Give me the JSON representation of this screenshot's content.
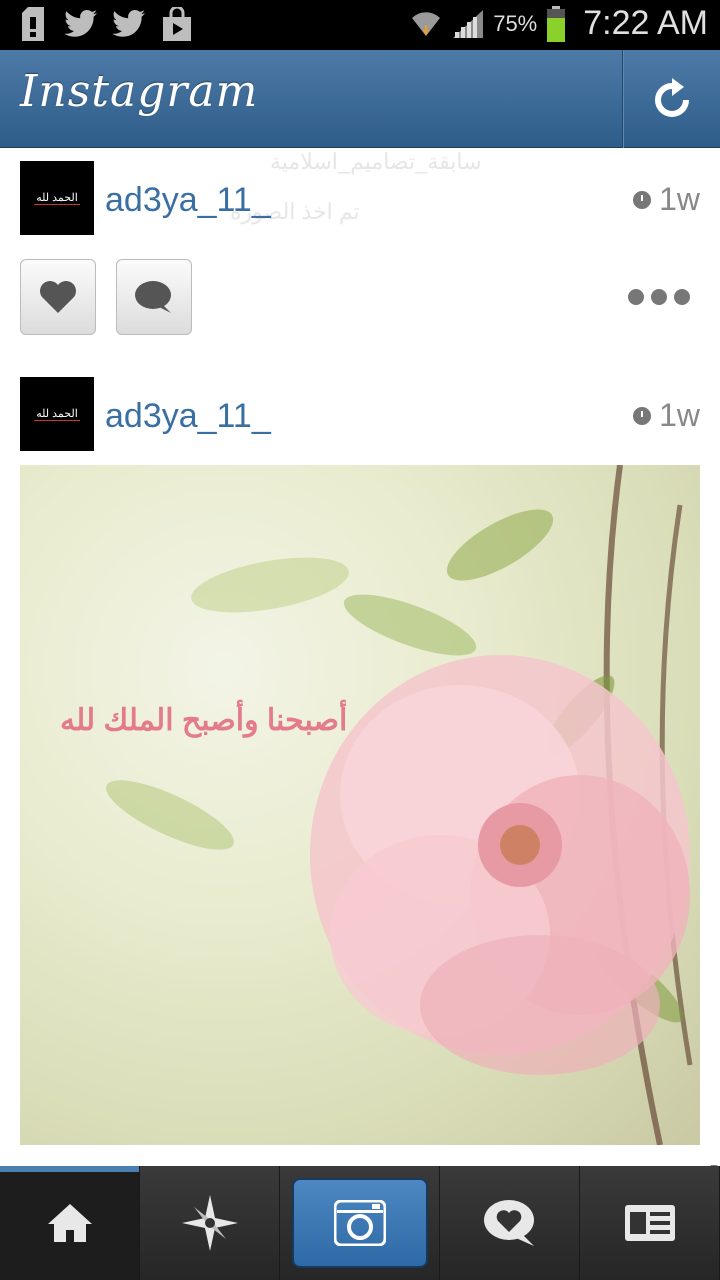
{
  "status_bar": {
    "battery_percent": "75%",
    "time": "7:22 AM",
    "icons": [
      "sd-card-icon",
      "twitter-icon",
      "twitter-icon",
      "shopping-bag-icon",
      "wifi-icon",
      "signal-icon",
      "battery-icon"
    ]
  },
  "header": {
    "app_title": "Instagram",
    "refresh_icon": "refresh-icon"
  },
  "feed": {
    "ghost_text_1": "سابقة_تصاميم_اسلامية",
    "ghost_text_2": "تم اخذ الصورة",
    "posts": [
      {
        "username": "ad3ya_11_",
        "time_ago": "1w",
        "avatar_text": "الحمد لله"
      },
      {
        "username": "ad3ya_11_",
        "time_ago": "1w",
        "avatar_text": "الحمد لله",
        "photo_caption": "أصبحنا وأصبح الملك لله"
      }
    ]
  },
  "tabs": [
    {
      "name": "home",
      "icon": "home-icon"
    },
    {
      "name": "explore",
      "icon": "compass-icon"
    },
    {
      "name": "camera",
      "icon": "camera-icon"
    },
    {
      "name": "news",
      "icon": "heart-bubble-icon"
    },
    {
      "name": "profile",
      "icon": "profile-card-icon"
    }
  ],
  "colors": {
    "accent": "#3a6fa3",
    "header": "#3f6d99"
  }
}
